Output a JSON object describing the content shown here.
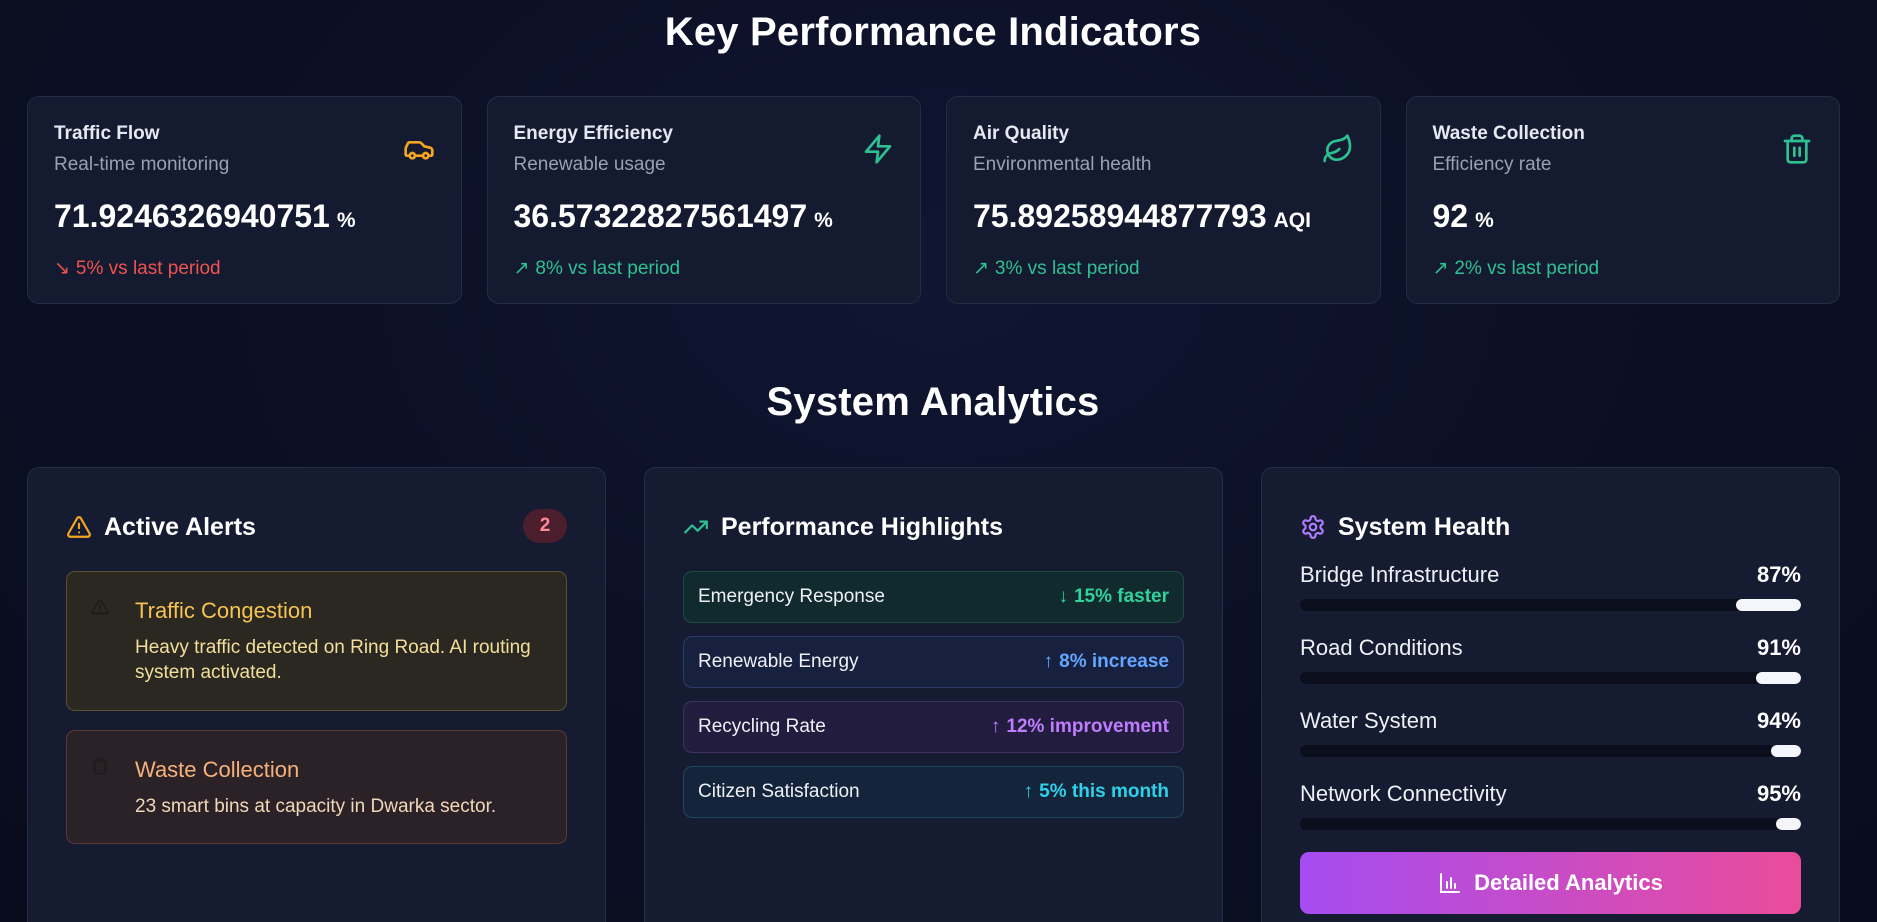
{
  "kpi": {
    "title": "Key Performance Indicators",
    "cards": [
      {
        "name": "Traffic Flow",
        "sub": "Real-time monitoring",
        "value": "71.9246326940751",
        "unit": "%",
        "trend_arrow": "↘",
        "trend": "5% vs last period",
        "icon": "car-icon"
      },
      {
        "name": "Energy Efficiency",
        "sub": "Renewable usage",
        "value": "36.57322827561497",
        "unit": "%",
        "trend_arrow": "↗",
        "trend": "8% vs last period",
        "icon": "lightning-icon"
      },
      {
        "name": "Air Quality",
        "sub": "Environmental health",
        "value": "75.89258944877793",
        "unit": "AQI",
        "trend_arrow": "↗",
        "trend": "3% vs last period",
        "icon": "leaf-icon"
      },
      {
        "name": "Waste Collection",
        "sub": "Efficiency rate",
        "value": "92",
        "unit": "%",
        "trend_arrow": "↗",
        "trend": "2% vs last period",
        "icon": "trash-icon"
      }
    ]
  },
  "analytics": {
    "title": "System Analytics",
    "alerts": {
      "title": "Active Alerts",
      "count": "2",
      "items": [
        {
          "title": "Traffic Congestion",
          "text": "Heavy traffic detected on Ring Road. AI routing system activated."
        },
        {
          "title": "Waste Collection",
          "text": "23 smart bins at capacity in Dwarka sector."
        }
      ]
    },
    "highlights": {
      "title": "Performance Highlights",
      "items": [
        {
          "label": "Emergency Response",
          "arrow": "↓",
          "value": "15% faster"
        },
        {
          "label": "Renewable Energy",
          "arrow": "↑",
          "value": "8% increase"
        },
        {
          "label": "Recycling Rate",
          "arrow": "↑",
          "value": "12% improvement"
        },
        {
          "label": "Citizen Satisfaction",
          "arrow": "↑",
          "value": "5% this month"
        }
      ]
    },
    "health": {
      "title": "System Health",
      "items": [
        {
          "label": "Bridge Infrastructure",
          "pct_text": "87%",
          "pct": 87
        },
        {
          "label": "Road Conditions",
          "pct_text": "91%",
          "pct": 91
        },
        {
          "label": "Water System",
          "pct_text": "94%",
          "pct": 94
        },
        {
          "label": "Network Connectivity",
          "pct_text": "95%",
          "pct": 95
        }
      ],
      "button_label": "Detailed Analytics"
    }
  },
  "colors": {
    "trend_down": "#ef5350",
    "trend_up": "#2fc092",
    "car_icon": "#f5a524",
    "green_icon": "#2fc092",
    "alert_icon": "#f5a524",
    "gear_icon": "#b17cff"
  }
}
